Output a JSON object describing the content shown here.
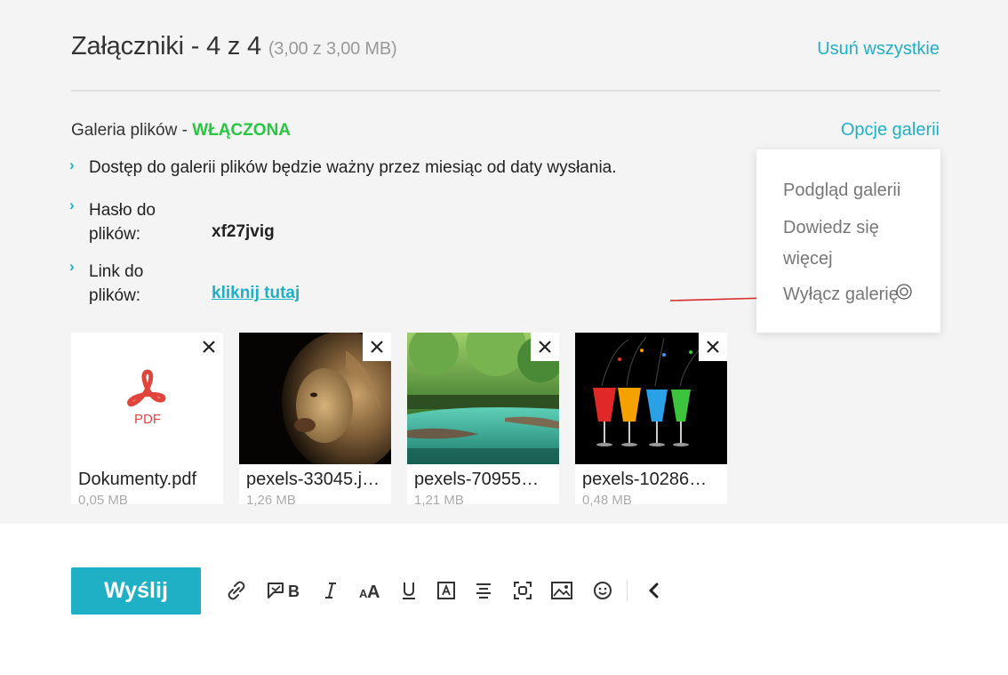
{
  "attachments": {
    "title": "Załączniki - 4 z 4",
    "size_info": "(3,00 z 3,00 MB)",
    "remove_all_label": "Usuń wszystkie"
  },
  "gallery": {
    "label": "Galeria plików - ",
    "state": "WŁĄCZONA",
    "options_label": "Opcje galerii",
    "info": {
      "access_text": "Dostęp do galerii plików będzie ważny przez miesiąc od daty wysłania.",
      "password_label": "Hasło do plików:",
      "password_value": "xf27jvig",
      "link_label": "Link do plików:",
      "link_value": "kliknij tutaj"
    },
    "menu": [
      {
        "label": "Podgląd galerii"
      },
      {
        "label": "Dowiedz się więcej"
      },
      {
        "label": "Wyłącz galerię"
      }
    ]
  },
  "files": [
    {
      "name": "Dokumenty.pdf",
      "size": "0,05 MB",
      "type": "pdf",
      "badge": "PDF"
    },
    {
      "name": "pexels-33045.j…",
      "size": "1,26 MB",
      "type": "image-lion"
    },
    {
      "name": "pexels-70955…",
      "size": "1,21 MB",
      "type": "image-river"
    },
    {
      "name": "pexels-10286…",
      "size": "0,48 MB",
      "type": "image-glasses"
    }
  ],
  "composer": {
    "send_label": "Wyślij",
    "toolbar_icons": [
      "link-icon",
      "sender-name-icon",
      "italic-icon",
      "font-size-icon",
      "underline-icon",
      "text-box-icon",
      "align-icon",
      "fullscreen-icon",
      "image-icon",
      "emoji-icon",
      "collapse-icon"
    ]
  },
  "colors": {
    "accent": "#1fb0c6",
    "enabled": "#28c640",
    "pdf": "#e0453c",
    "annotation_arrow": "#d62b2b"
  }
}
